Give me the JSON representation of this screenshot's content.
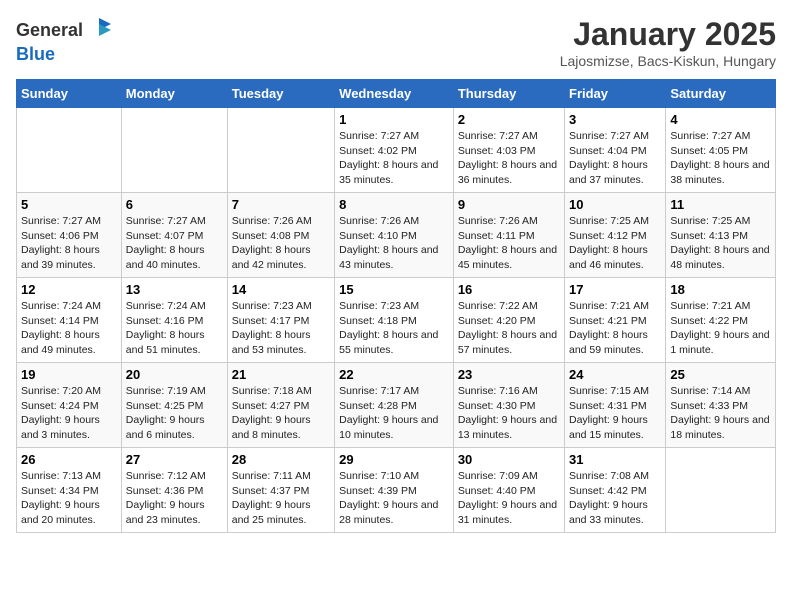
{
  "header": {
    "logo_general": "General",
    "logo_blue": "Blue",
    "title": "January 2025",
    "subtitle": "Lajosmizse, Bacs-Kiskun, Hungary"
  },
  "days_of_week": [
    "Sunday",
    "Monday",
    "Tuesday",
    "Wednesday",
    "Thursday",
    "Friday",
    "Saturday"
  ],
  "weeks": [
    [
      {
        "day": "",
        "info": ""
      },
      {
        "day": "",
        "info": ""
      },
      {
        "day": "",
        "info": ""
      },
      {
        "day": "1",
        "info": "Sunrise: 7:27 AM\nSunset: 4:02 PM\nDaylight: 8 hours and 35 minutes."
      },
      {
        "day": "2",
        "info": "Sunrise: 7:27 AM\nSunset: 4:03 PM\nDaylight: 8 hours and 36 minutes."
      },
      {
        "day": "3",
        "info": "Sunrise: 7:27 AM\nSunset: 4:04 PM\nDaylight: 8 hours and 37 minutes."
      },
      {
        "day": "4",
        "info": "Sunrise: 7:27 AM\nSunset: 4:05 PM\nDaylight: 8 hours and 38 minutes."
      }
    ],
    [
      {
        "day": "5",
        "info": "Sunrise: 7:27 AM\nSunset: 4:06 PM\nDaylight: 8 hours and 39 minutes."
      },
      {
        "day": "6",
        "info": "Sunrise: 7:27 AM\nSunset: 4:07 PM\nDaylight: 8 hours and 40 minutes."
      },
      {
        "day": "7",
        "info": "Sunrise: 7:26 AM\nSunset: 4:08 PM\nDaylight: 8 hours and 42 minutes."
      },
      {
        "day": "8",
        "info": "Sunrise: 7:26 AM\nSunset: 4:10 PM\nDaylight: 8 hours and 43 minutes."
      },
      {
        "day": "9",
        "info": "Sunrise: 7:26 AM\nSunset: 4:11 PM\nDaylight: 8 hours and 45 minutes."
      },
      {
        "day": "10",
        "info": "Sunrise: 7:25 AM\nSunset: 4:12 PM\nDaylight: 8 hours and 46 minutes."
      },
      {
        "day": "11",
        "info": "Sunrise: 7:25 AM\nSunset: 4:13 PM\nDaylight: 8 hours and 48 minutes."
      }
    ],
    [
      {
        "day": "12",
        "info": "Sunrise: 7:24 AM\nSunset: 4:14 PM\nDaylight: 8 hours and 49 minutes."
      },
      {
        "day": "13",
        "info": "Sunrise: 7:24 AM\nSunset: 4:16 PM\nDaylight: 8 hours and 51 minutes."
      },
      {
        "day": "14",
        "info": "Sunrise: 7:23 AM\nSunset: 4:17 PM\nDaylight: 8 hours and 53 minutes."
      },
      {
        "day": "15",
        "info": "Sunrise: 7:23 AM\nSunset: 4:18 PM\nDaylight: 8 hours and 55 minutes."
      },
      {
        "day": "16",
        "info": "Sunrise: 7:22 AM\nSunset: 4:20 PM\nDaylight: 8 hours and 57 minutes."
      },
      {
        "day": "17",
        "info": "Sunrise: 7:21 AM\nSunset: 4:21 PM\nDaylight: 8 hours and 59 minutes."
      },
      {
        "day": "18",
        "info": "Sunrise: 7:21 AM\nSunset: 4:22 PM\nDaylight: 9 hours and 1 minute."
      }
    ],
    [
      {
        "day": "19",
        "info": "Sunrise: 7:20 AM\nSunset: 4:24 PM\nDaylight: 9 hours and 3 minutes."
      },
      {
        "day": "20",
        "info": "Sunrise: 7:19 AM\nSunset: 4:25 PM\nDaylight: 9 hours and 6 minutes."
      },
      {
        "day": "21",
        "info": "Sunrise: 7:18 AM\nSunset: 4:27 PM\nDaylight: 9 hours and 8 minutes."
      },
      {
        "day": "22",
        "info": "Sunrise: 7:17 AM\nSunset: 4:28 PM\nDaylight: 9 hours and 10 minutes."
      },
      {
        "day": "23",
        "info": "Sunrise: 7:16 AM\nSunset: 4:30 PM\nDaylight: 9 hours and 13 minutes."
      },
      {
        "day": "24",
        "info": "Sunrise: 7:15 AM\nSunset: 4:31 PM\nDaylight: 9 hours and 15 minutes."
      },
      {
        "day": "25",
        "info": "Sunrise: 7:14 AM\nSunset: 4:33 PM\nDaylight: 9 hours and 18 minutes."
      }
    ],
    [
      {
        "day": "26",
        "info": "Sunrise: 7:13 AM\nSunset: 4:34 PM\nDaylight: 9 hours and 20 minutes."
      },
      {
        "day": "27",
        "info": "Sunrise: 7:12 AM\nSunset: 4:36 PM\nDaylight: 9 hours and 23 minutes."
      },
      {
        "day": "28",
        "info": "Sunrise: 7:11 AM\nSunset: 4:37 PM\nDaylight: 9 hours and 25 minutes."
      },
      {
        "day": "29",
        "info": "Sunrise: 7:10 AM\nSunset: 4:39 PM\nDaylight: 9 hours and 28 minutes."
      },
      {
        "day": "30",
        "info": "Sunrise: 7:09 AM\nSunset: 4:40 PM\nDaylight: 9 hours and 31 minutes."
      },
      {
        "day": "31",
        "info": "Sunrise: 7:08 AM\nSunset: 4:42 PM\nDaylight: 9 hours and 33 minutes."
      },
      {
        "day": "",
        "info": ""
      }
    ]
  ]
}
